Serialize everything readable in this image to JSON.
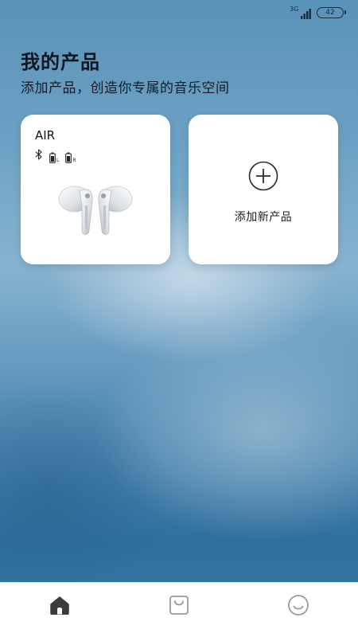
{
  "status_bar": {
    "network": "3G",
    "battery": "42"
  },
  "header": {
    "title": "我的产品",
    "subtitle": "添加产品，创造你专属的音乐空间"
  },
  "product_card": {
    "name": "AIR",
    "left_label": "L",
    "right_label": "R",
    "icons": [
      "bluetooth-icon",
      "battery-left-icon",
      "battery-right-icon",
      "earbuds-image"
    ]
  },
  "add_card": {
    "label": "添加新产品",
    "icon": "plus-circle-icon"
  },
  "tab_bar": {
    "items": [
      {
        "icon": "home-icon",
        "active": true
      },
      {
        "icon": "shop-bag-icon",
        "active": false
      },
      {
        "icon": "smiley-profile-icon",
        "active": false
      }
    ]
  }
}
